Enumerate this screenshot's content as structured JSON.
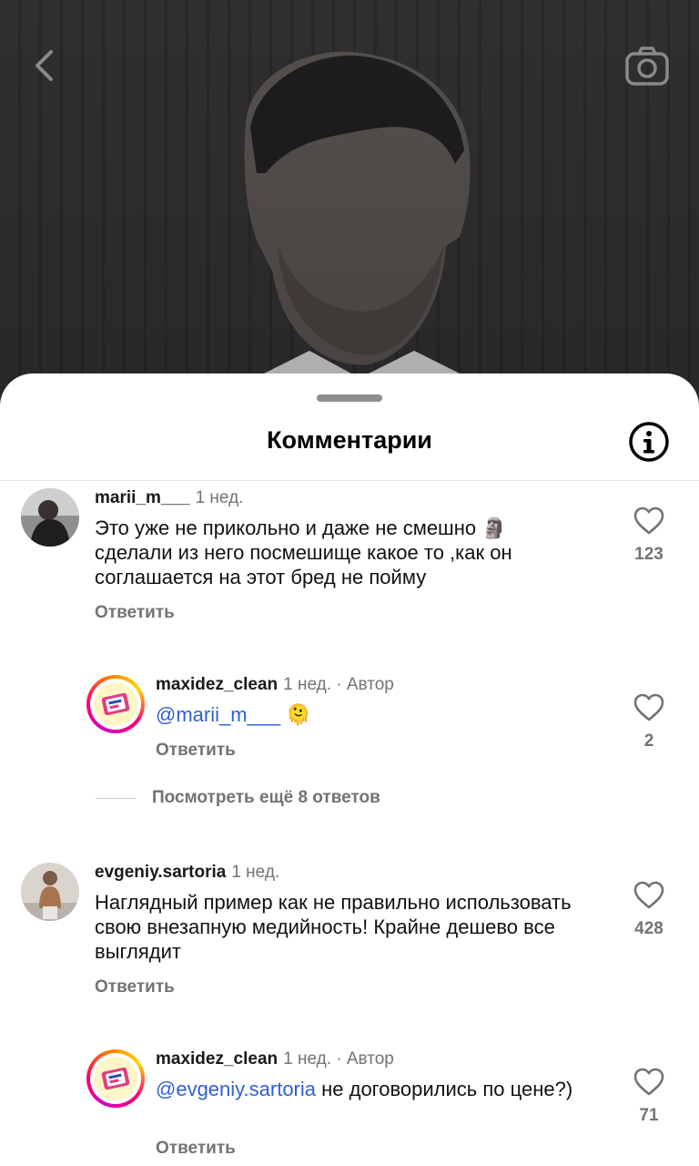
{
  "sheet": {
    "title": "Комментарии"
  },
  "comments": [
    {
      "username": "marii_m___",
      "time": "1 нед.",
      "text": "Это уже не прикольно и даже не смешно 🗿 сделали из него посмешище какое то ,как он соглашается на этот бред не пойму",
      "reply_label": "Ответить",
      "likes": "123"
    },
    {
      "username": "maxidez_clean",
      "time": "1 нед.",
      "author_label": "· Автор",
      "mention": "@marii_m___",
      "text": "🫠",
      "reply_label": "Ответить",
      "likes": "2"
    },
    {
      "username": "evgeniy.sartoria",
      "time": "1 нед.",
      "text": "Наглядный пример как не правильно использовать свою внезапную медийность! Крайне дешево все выглядит",
      "reply_label": "Ответить",
      "likes": "428"
    },
    {
      "username": "maxidez_clean",
      "time": "1 нед.",
      "author_label": "· Автор",
      "mention": "@evgeniy.sartoria",
      "text": " не договорились по цене?)",
      "reply_label": "Ответить",
      "likes": "71"
    }
  ],
  "more_replies": "Посмотреть ещё 8 ответов",
  "icons": {
    "back": "chevron-left-icon",
    "camera": "camera-icon",
    "info": "info-icon",
    "like": "heart-icon"
  },
  "colors": {
    "mention": "#2f5fd6",
    "secondary_text": "#737373"
  }
}
